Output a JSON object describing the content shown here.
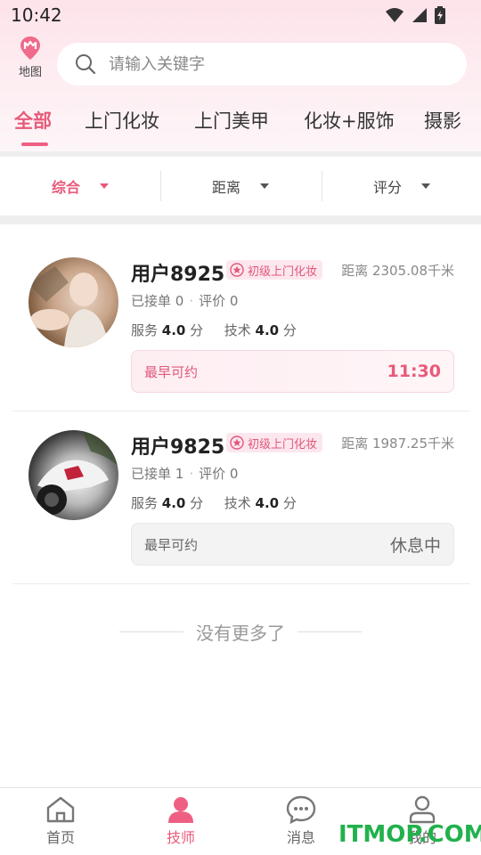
{
  "status_bar": {
    "time": "10:42"
  },
  "header": {
    "map_label": "地图",
    "search_placeholder": "请输入关键字"
  },
  "tabs": [
    {
      "label": "全部",
      "active": true
    },
    {
      "label": "上门化妆"
    },
    {
      "label": "上门美甲"
    },
    {
      "label": "化妆+服饰"
    },
    {
      "label": "摄影"
    }
  ],
  "filters": [
    {
      "label": "综合",
      "active": true
    },
    {
      "label": "距离"
    },
    {
      "label": "评分"
    }
  ],
  "technicians": [
    {
      "name": "用户8925",
      "badge": "初级上门化妆",
      "distance": "距离 2305.08千米",
      "orders_label": "已接单 0",
      "reviews_label": "评价 0",
      "service_label": "服务",
      "service_score": "4.0",
      "tech_label": "技术",
      "tech_score": "4.0",
      "score_unit": "分",
      "avail_label": "最早可约",
      "avail_value": "11:30"
    },
    {
      "name": "用户9825",
      "badge": "初级上门化妆",
      "distance": "距离 1987.25千米",
      "orders_label": "已接单 1",
      "reviews_label": "评价 0",
      "service_label": "服务",
      "service_score": "4.0",
      "tech_label": "技术",
      "tech_score": "4.0",
      "score_unit": "分",
      "avail_label": "最早可约",
      "avail_value": "休息中"
    }
  ],
  "list_end_text": "没有更多了",
  "bottom_nav": [
    {
      "label": "首页",
      "icon": "home-icon"
    },
    {
      "label": "技师",
      "icon": "technician-icon",
      "active": true
    },
    {
      "label": "消息",
      "icon": "message-icon"
    },
    {
      "label": "我的",
      "icon": "profile-icon"
    }
  ],
  "watermark": "ITMOP.COM",
  "colors": {
    "accent": "#e85a7a",
    "watermark": "#22b14c"
  }
}
